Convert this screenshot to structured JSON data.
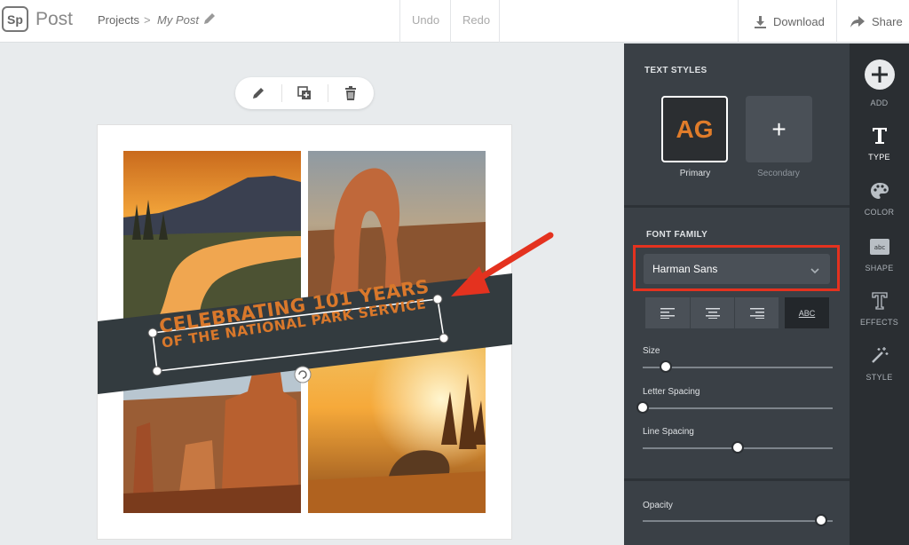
{
  "app": {
    "logo": "Sp",
    "name": "Post"
  },
  "breadcrumb": {
    "projects": "Projects",
    "separator": ">",
    "current": "My Post"
  },
  "toolbar": {
    "undo": "Undo",
    "redo": "Redo",
    "download": "Download",
    "share": "Share"
  },
  "canvas": {
    "headline_line1": "CELEBRATING 101 YEARS",
    "headline_line2": "OF THE NATIONAL PARK SERVICE"
  },
  "panel": {
    "text_styles_title": "TEXT STYLES",
    "primary_sample": "AG",
    "primary_label": "Primary",
    "secondary_symbol": "+",
    "secondary_label": "Secondary",
    "font_family_title": "FONT FAMILY",
    "font_family_value": "Harman Sans",
    "abc_label": "ABC",
    "size_label": "Size",
    "size_value": 0.12,
    "letter_spacing_label": "Letter Spacing",
    "letter_spacing_value": 0.0,
    "line_spacing_label": "Line Spacing",
    "line_spacing_value": 0.5,
    "opacity_label": "Opacity",
    "opacity_value": 0.94
  },
  "rail": {
    "add": "ADD",
    "type": "TYPE",
    "color": "COLOR",
    "shape": "SHAPE",
    "effects": "EFFECTS",
    "style": "STYLE"
  },
  "colors": {
    "accent": "#e07c2a",
    "highlight": "#e4321f",
    "panel": "#3a4046",
    "banner": "#333b3f"
  }
}
